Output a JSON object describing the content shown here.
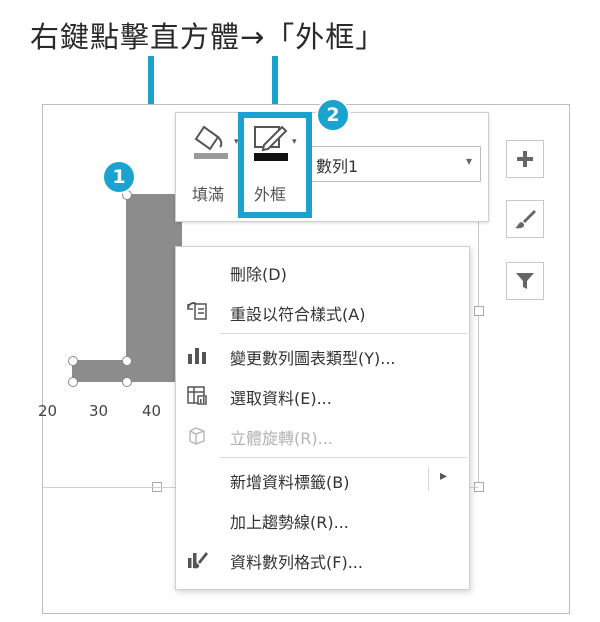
{
  "instruction": "右鍵點擊直方體→「外框」",
  "callouts": {
    "badge1": "1",
    "badge2": "2"
  },
  "axis": {
    "ticks": [
      "20",
      "30",
      "40"
    ]
  },
  "format_toolbar": {
    "fill_label": "填滿",
    "outline_label": "外框",
    "series_select": "數列1"
  },
  "context_menu": {
    "items": [
      {
        "label": "刪除(D)",
        "icon": "",
        "disabled": false
      },
      {
        "label": "重設以符合樣式(A)",
        "icon": "reset-style-icon",
        "disabled": false
      },
      {
        "label": "變更數列圖表類型(Y)...",
        "icon": "chart-type-icon",
        "disabled": false
      },
      {
        "label": "選取資料(E)...",
        "icon": "select-data-icon",
        "disabled": false
      },
      {
        "label": "立體旋轉(R)...",
        "icon": "3d-rotate-icon",
        "disabled": true
      },
      {
        "label": "新增資料標籤(B)",
        "icon": "",
        "disabled": false
      },
      {
        "label": "加上趨勢線(R)...",
        "icon": "",
        "disabled": false
      },
      {
        "label": "資料數列格式(F)...",
        "icon": "format-series-icon",
        "disabled": false
      }
    ],
    "submenu_arrow": "▸"
  },
  "side_buttons": [
    "plus-icon",
    "brush-icon",
    "filter-icon"
  ],
  "colors": {
    "accent": "#1aa3cf",
    "bar": "#8c8c8c"
  }
}
